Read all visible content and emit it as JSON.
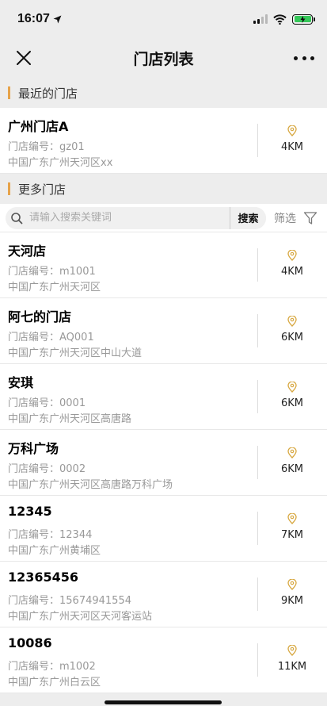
{
  "status": {
    "time": "16:07"
  },
  "nav": {
    "title": "门店列表"
  },
  "sections": {
    "recent": "最近的门店",
    "more": "更多门店"
  },
  "recent_stores": [
    {
      "name": "广州门店A",
      "code": "门店编号：gz01",
      "address": "中国广东广州天河区xx",
      "distance": "4KM"
    }
  ],
  "search": {
    "placeholder": "请输入搜索关键词",
    "button": "搜索",
    "filter": "筛选"
  },
  "stores": [
    {
      "name": "天河店",
      "code": "门店编号：m1001",
      "address": "中国广东广州天河区",
      "distance": "4KM"
    },
    {
      "name": "阿七的门店",
      "code": "门店编号：AQ001",
      "address": "中国广东广州天河区中山大道",
      "distance": "6KM"
    },
    {
      "name": "安琪",
      "code": "门店编号：0001",
      "address": "中国广东广州天河区高唐路",
      "distance": "6KM"
    },
    {
      "name": "万科广场",
      "code": "门店编号：0002",
      "address": "中国广东广州天河区高唐路万科广场",
      "distance": "6KM"
    },
    {
      "name": "12345",
      "code": "门店编号：12344",
      "address": "中国广东广州黄埔区",
      "distance": "7KM"
    },
    {
      "name": "12365456",
      "code": "门店编号：15674941554",
      "address": "中国广东广州天河区天河客运站",
      "distance": "9KM"
    },
    {
      "name": "10086",
      "code": "门店编号：m1002",
      "address": "中国广东广州白云区",
      "distance": "11KM"
    }
  ],
  "colors": {
    "accent": "#e6a34a",
    "battery": "#35c759"
  }
}
